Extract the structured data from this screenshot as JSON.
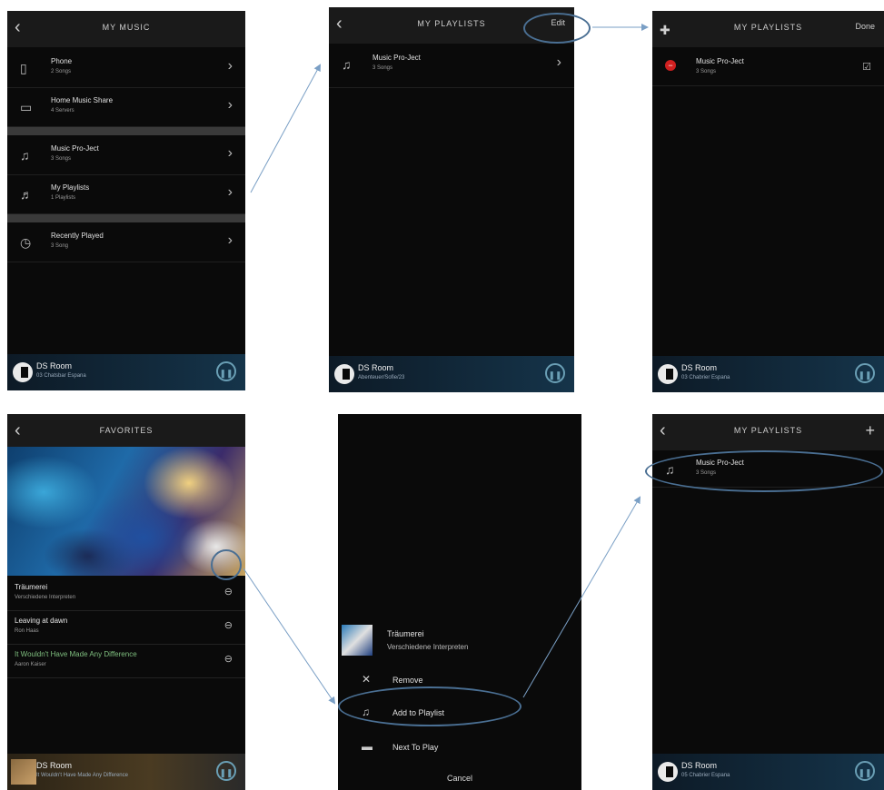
{
  "screen1": {
    "title": "MY MUSIC",
    "rows": [
      {
        "title": "Phone",
        "sub": "2 Songs",
        "icon": "phone-icon"
      },
      {
        "title": "Home Music Share",
        "sub": "4 Servers",
        "icon": "server-icon"
      },
      {
        "title": "Music Pro-Ject",
        "sub": "3 Songs",
        "icon": "music-note-icon"
      },
      {
        "title": "My Playlists",
        "sub": "1 Playlists",
        "icon": "playlist-icon"
      },
      {
        "title": "Recently Played",
        "sub": "3 Song",
        "icon": "clock-icon"
      }
    ],
    "footer": {
      "room": "DS Room",
      "track": "03 Chatsbar Espana"
    }
  },
  "screen2": {
    "title": "MY PLAYLISTS",
    "edit_label": "Edit",
    "rows": [
      {
        "title": "Music Pro-Ject",
        "sub": "3 Songs"
      }
    ],
    "footer": {
      "room": "DS Room",
      "track": "Abenteuer/Sofie/23"
    }
  },
  "screen3": {
    "title": "MY PLAYLISTS",
    "done_label": "Done",
    "rows": [
      {
        "title": "Music Pro-Ject",
        "sub": "3 Songs"
      }
    ],
    "footer": {
      "room": "DS Room",
      "track": "03 Chabrier Espana"
    }
  },
  "screen4": {
    "title": "FAVORITES",
    "songs": [
      {
        "title": "Träumerei",
        "sub": "Verschiedene Interpreten"
      },
      {
        "title": "Leaving at dawn",
        "sub": "Ron Haas"
      },
      {
        "title": "It Wouldn't Have Made Any Difference",
        "sub": "Aaron Kaiser"
      }
    ],
    "footer": {
      "room": "DS Room",
      "track": "It Wouldn't Have Made Any Difference"
    }
  },
  "screen5": {
    "track": {
      "title": "Träumerei",
      "sub": "Verschiedene Interpreten"
    },
    "menu": [
      {
        "label": "Remove",
        "icon": "close-icon"
      },
      {
        "label": "Add to Playlist",
        "icon": "add-playlist-icon"
      },
      {
        "label": "Next To Play",
        "icon": "queue-icon"
      }
    ],
    "cancel_label": "Cancel"
  },
  "screen6": {
    "title": "MY PLAYLISTS",
    "add_label": "+",
    "rows": [
      {
        "title": "Music Pro-Ject",
        "sub": "3 Songs"
      }
    ],
    "footer": {
      "room": "DS Room",
      "track": "05 Chabrier Espana"
    }
  },
  "colors": {
    "highlight": "#4a6f93",
    "arrow": "#7a9fc5",
    "accent_green": "#7fbf7f"
  }
}
